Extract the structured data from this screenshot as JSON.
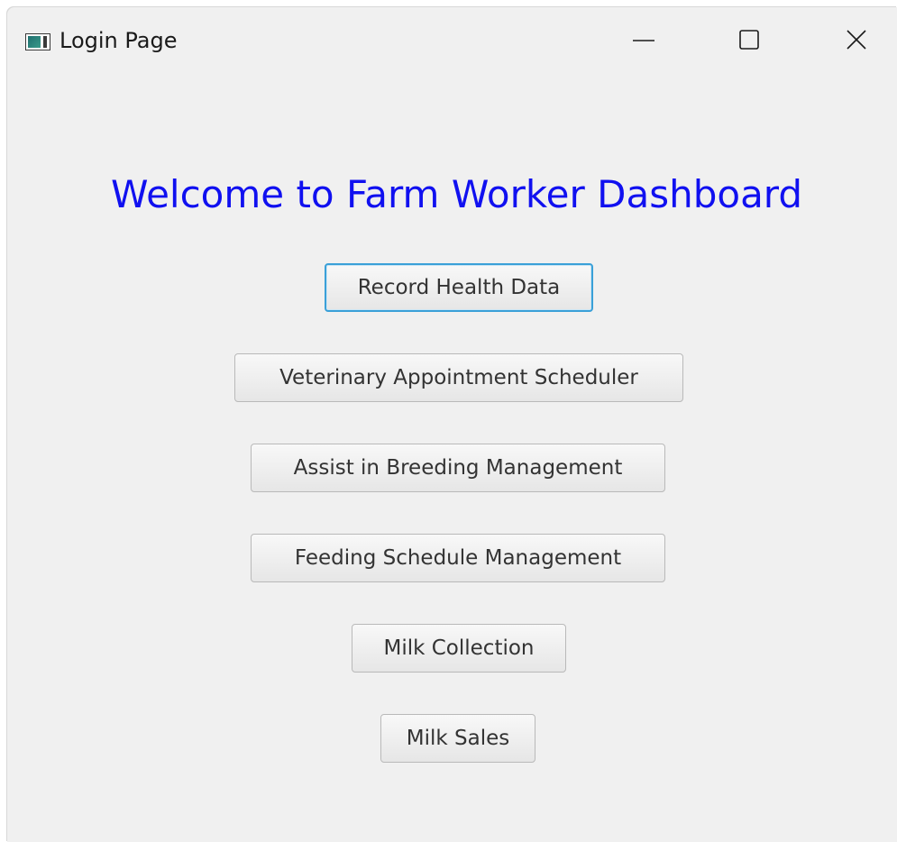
{
  "window": {
    "title": "Login Page",
    "controls": {
      "minimize_icon": "minimize-icon",
      "maximize_icon": "maximize-icon",
      "close_icon": "close-icon"
    }
  },
  "main": {
    "heading": "Welcome to Farm Worker Dashboard",
    "heading_color": "#1010f0",
    "focus_color": "#3aa0d8",
    "buttons": [
      {
        "label": "Record Health Data",
        "focused": true
      },
      {
        "label": "Veterinary Appointment Scheduler",
        "focused": false
      },
      {
        "label": "Assist in Breeding Management",
        "focused": false
      },
      {
        "label": "Feeding Schedule Management",
        "focused": false
      },
      {
        "label": "Milk Collection",
        "focused": false
      },
      {
        "label": "Milk Sales",
        "focused": false
      }
    ]
  }
}
